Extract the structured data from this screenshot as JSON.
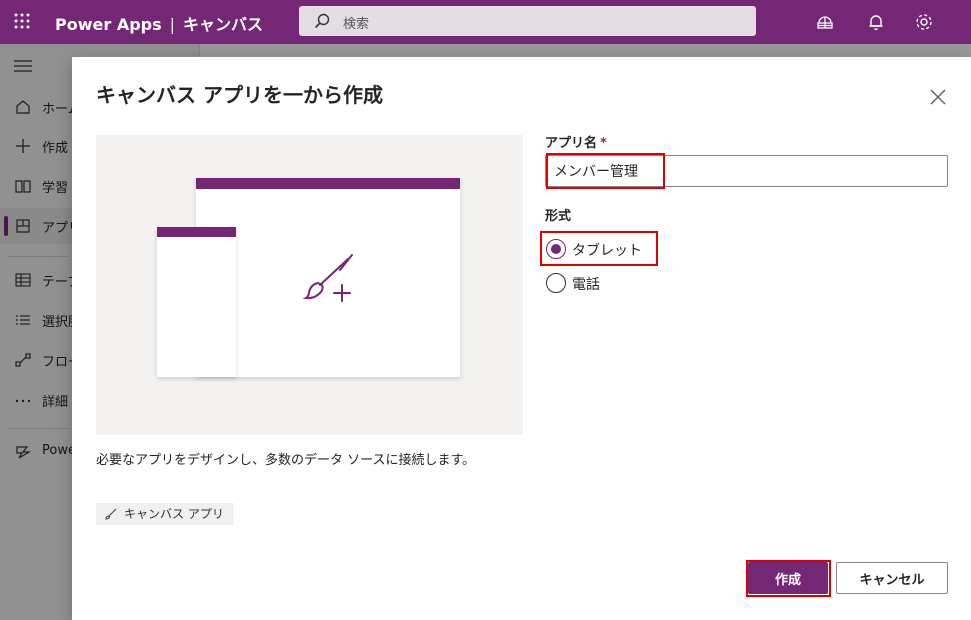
{
  "topbar": {
    "app_name": "Power Apps",
    "separator": "|",
    "env_name": "キャンバス",
    "search_placeholder": "検索",
    "icons": [
      "waffle-icon",
      "search-icon",
      "environment-icon",
      "bell-icon",
      "gear-icon"
    ]
  },
  "leftnav": {
    "items": [
      {
        "label": "ホーム",
        "icon": "home-icon"
      },
      {
        "label": "作成",
        "icon": "plus-icon"
      },
      {
        "label": "学習",
        "icon": "book-icon"
      },
      {
        "label": "アプリ",
        "icon": "apps-icon",
        "active": true
      },
      {
        "label": "テーブル",
        "icon": "table-icon"
      },
      {
        "label": "選択肢",
        "icon": "list-icon"
      },
      {
        "label": "フロー",
        "icon": "flow-icon"
      },
      {
        "label": "詳細",
        "icon": "more-icon"
      },
      {
        "label": "Power Platform",
        "icon": "power-platform-icon"
      }
    ]
  },
  "dialog": {
    "title": "キャンバス アプリを一から作成",
    "description": "必要なアプリをデザインし、多数のデータ ソースに接続します。",
    "tag_label": "キャンバス アプリ",
    "app_name_label": "アプリ名",
    "required_marker": "*",
    "app_name_value": "メンバー管理",
    "format_label": "形式",
    "format_options": [
      {
        "label": "タブレット",
        "checked": true
      },
      {
        "label": "電話",
        "checked": false
      }
    ],
    "create_label": "作成",
    "cancel_label": "キャンセル"
  },
  "colors": {
    "brand": "#742774",
    "highlight": "#e00000",
    "required": "#a4262c"
  }
}
